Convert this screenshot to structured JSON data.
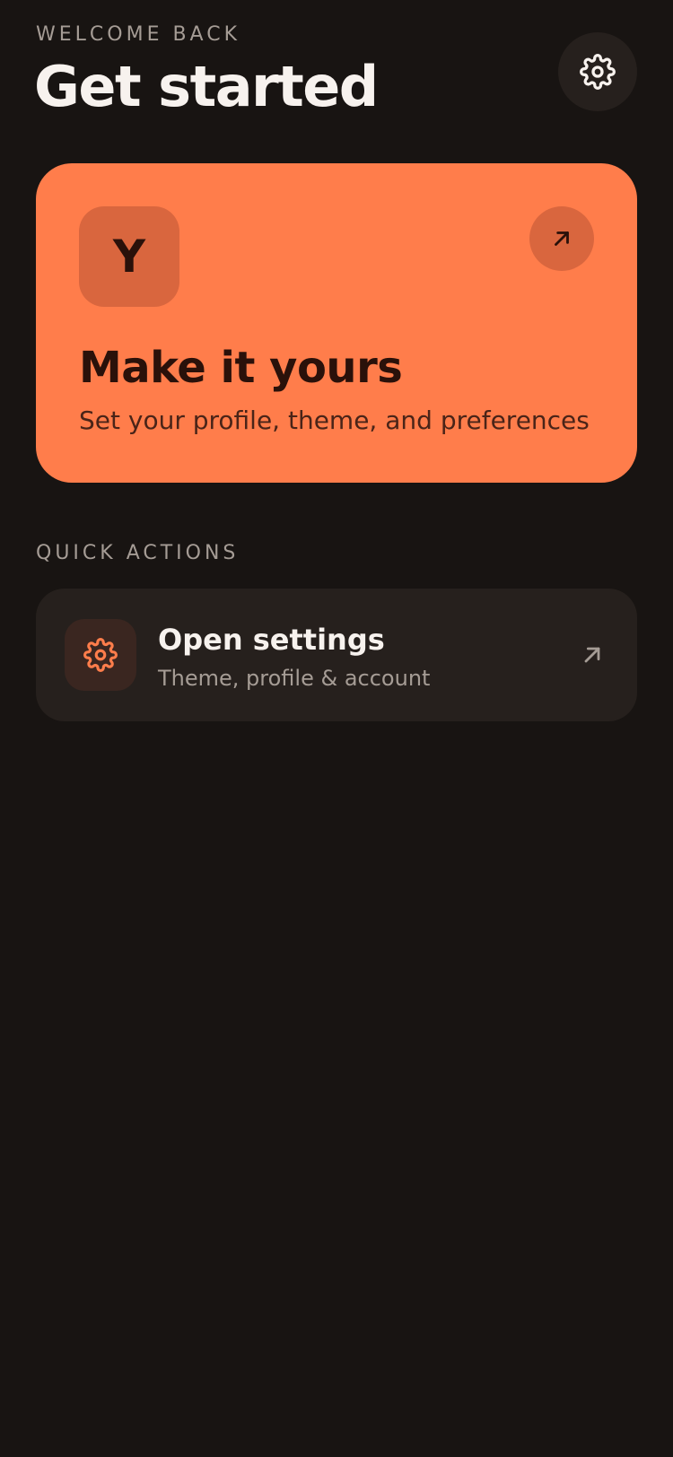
{
  "header": {
    "eyebrow": "WELCOME BACK",
    "title": "Get started",
    "settings_icon": "gear-icon"
  },
  "hero": {
    "avatar_letter": "Y",
    "title": "Make it yours",
    "subtitle": "Set your profile, theme, and preferences",
    "arrow_icon": "arrow-up-right-icon",
    "color": "#ff7d4b"
  },
  "quick_actions": {
    "label": "QUICK ACTIONS",
    "items": [
      {
        "title": "Open settings",
        "subtitle": "Theme, profile & account",
        "icon": "gear-icon",
        "arrow_icon": "arrow-up-right-icon"
      }
    ]
  },
  "colors": {
    "background": "#181412",
    "accent": "#ff7d4b",
    "card": "#26201d"
  }
}
